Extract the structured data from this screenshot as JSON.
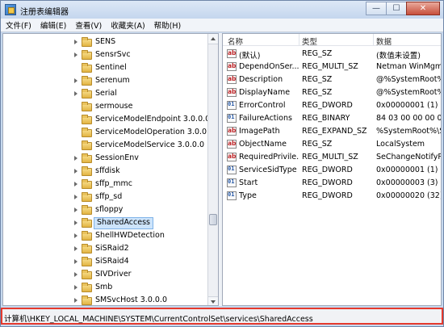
{
  "window": {
    "title": "注册表编辑器",
    "minimize": "—",
    "maximize": "☐",
    "close": "✕"
  },
  "menu": [
    "文件(F)",
    "编辑(E)",
    "查看(V)",
    "收藏夹(A)",
    "帮助(H)"
  ],
  "tree": {
    "items": [
      "SENS",
      "SensrSvc",
      "Sentinel",
      "Serenum",
      "Serial",
      "sermouse",
      "ServiceModelEndpoint 3.0.0.0",
      "ServiceModelOperation 3.0.0.0",
      "ServiceModelService 3.0.0.0",
      "SessionEnv",
      "sffdisk",
      "sffp_mmc",
      "sffp_sd",
      "sfloppy",
      "SharedAccess",
      "ShellHWDetection",
      "SiSRaid2",
      "SiSRaid4",
      "SIVDriver",
      "Smb",
      "SMSvcHost 3.0.0.0"
    ],
    "selected": "SharedAccess"
  },
  "values": {
    "columns": {
      "name": "名称",
      "type": "类型",
      "data": "数据"
    },
    "rows": [
      {
        "icon": "string-value-icon",
        "name": "(默认)",
        "type": "REG_SZ",
        "data": "(数值未设置)"
      },
      {
        "icon": "string-value-icon",
        "name": "DependOnSer...",
        "type": "REG_MULTI_SZ",
        "data": "Netman WinMgm"
      },
      {
        "icon": "string-value-icon",
        "name": "Description",
        "type": "REG_SZ",
        "data": "@%SystemRoot%"
      },
      {
        "icon": "string-value-icon",
        "name": "DisplayName",
        "type": "REG_SZ",
        "data": "@%SystemRoot%"
      },
      {
        "icon": "binary-value-icon",
        "name": "ErrorControl",
        "type": "REG_DWORD",
        "data": "0x00000001 (1)"
      },
      {
        "icon": "binary-value-icon",
        "name": "FailureActions",
        "type": "REG_BINARY",
        "data": "84 03 00 00 00 00"
      },
      {
        "icon": "string-value-icon",
        "name": "ImagePath",
        "type": "REG_EXPAND_SZ",
        "data": "%SystemRoot%\\S"
      },
      {
        "icon": "string-value-icon",
        "name": "ObjectName",
        "type": "REG_SZ",
        "data": "LocalSystem"
      },
      {
        "icon": "string-value-icon",
        "name": "RequiredPrivile...",
        "type": "REG_MULTI_SZ",
        "data": "SeChangeNotifyP"
      },
      {
        "icon": "binary-value-icon",
        "name": "ServiceSidType",
        "type": "REG_DWORD",
        "data": "0x00000001 (1)"
      },
      {
        "icon": "binary-value-icon",
        "name": "Start",
        "type": "REG_DWORD",
        "data": "0x00000003 (3)"
      },
      {
        "icon": "binary-value-icon",
        "name": "Type",
        "type": "REG_DWORD",
        "data": "0x00000020 (32)"
      }
    ]
  },
  "status": {
    "path": "计算机\\HKEY_LOCAL_MACHINE\\SYSTEM\\CurrentControlSet\\services\\SharedAccess"
  },
  "colors": {
    "highlight_border": "#e53a2e",
    "selection": "#cde4fb"
  }
}
